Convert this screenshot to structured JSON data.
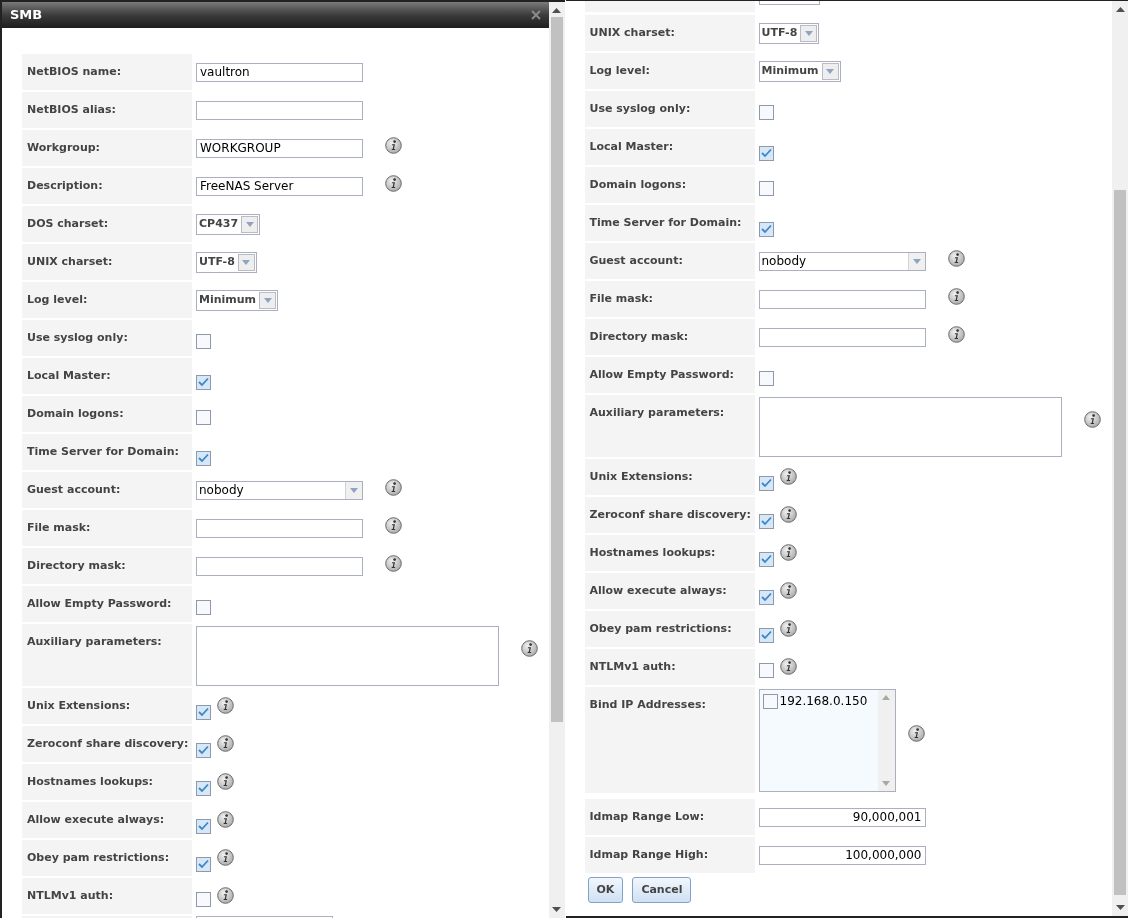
{
  "left": {
    "title": "SMB",
    "rows": [
      {
        "kind": "text",
        "label": "NetBIOS name:",
        "value": "vaultron",
        "info": false
      },
      {
        "kind": "text",
        "label": "NetBIOS alias:",
        "info": false
      },
      {
        "kind": "text",
        "label": "Workgroup:",
        "value": "WORKGROUP",
        "info": true
      },
      {
        "kind": "text",
        "label": "Description:",
        "value": "FreeNAS Server",
        "info": true
      },
      {
        "kind": "select",
        "label": "DOS charset:",
        "value": "CP437",
        "info": false
      },
      {
        "kind": "select",
        "label": "UNIX charset:",
        "value": "UTF-8",
        "info": false
      },
      {
        "kind": "select",
        "label": "Log level:",
        "value": "Minimum",
        "info": false
      },
      {
        "kind": "checkbox",
        "label": "Use syslog only:",
        "checked": false,
        "info": false
      },
      {
        "kind": "checkbox",
        "label": "Local Master:",
        "checked": true,
        "info": false
      },
      {
        "kind": "checkbox",
        "label": "Domain logons:",
        "checked": false,
        "info": false
      },
      {
        "kind": "checkbox",
        "label": "Time Server for Domain:",
        "checked": true,
        "info": false
      },
      {
        "kind": "combo",
        "label": "Guest account:",
        "value": "nobody",
        "info": true
      },
      {
        "kind": "text",
        "label": "File mask:",
        "info": true
      },
      {
        "kind": "text",
        "label": "Directory mask:",
        "info": true
      },
      {
        "kind": "checkbox",
        "label": "Allow Empty Password:",
        "checked": false,
        "info": false
      },
      {
        "kind": "textarea",
        "label": "Auxiliary parameters:",
        "info": true
      },
      {
        "kind": "checkbox",
        "label": "Unix Extensions:",
        "checked": true,
        "info": true
      },
      {
        "kind": "checkbox",
        "label": "Zeroconf share discovery:",
        "checked": true,
        "info": true
      },
      {
        "kind": "checkbox",
        "label": "Hostnames lookups:",
        "checked": true,
        "info": true
      },
      {
        "kind": "checkbox",
        "label": "Allow execute always:",
        "checked": true,
        "info": true
      },
      {
        "kind": "checkbox",
        "label": "Obey pam restrictions:",
        "checked": true,
        "info": true
      },
      {
        "kind": "checkbox",
        "label": "NTLMv1 auth:",
        "checked": false,
        "info": true
      }
    ]
  },
  "right": {
    "rows": [
      {
        "kind": "select",
        "label": "UNIX charset:",
        "value": "UTF-8",
        "info": false
      },
      {
        "kind": "select",
        "label": "Log level:",
        "value": "Minimum",
        "info": false
      },
      {
        "kind": "checkbox",
        "label": "Use syslog only:",
        "checked": false,
        "info": false
      },
      {
        "kind": "checkbox",
        "label": "Local Master:",
        "checked": true,
        "info": false
      },
      {
        "kind": "checkbox",
        "label": "Domain logons:",
        "checked": false,
        "info": false
      },
      {
        "kind": "checkbox",
        "label": "Time Server for Domain:",
        "checked": true,
        "info": false
      },
      {
        "kind": "combo",
        "label": "Guest account:",
        "value": "nobody",
        "info": true
      },
      {
        "kind": "text",
        "label": "File mask:",
        "info": true
      },
      {
        "kind": "text",
        "label": "Directory mask:",
        "info": true
      },
      {
        "kind": "checkbox",
        "label": "Allow Empty Password:",
        "checked": false,
        "info": false
      },
      {
        "kind": "textarea",
        "label": "Auxiliary parameters:",
        "info": true
      },
      {
        "kind": "checkbox",
        "label": "Unix Extensions:",
        "checked": true,
        "info": true
      },
      {
        "kind": "checkbox",
        "label": "Zeroconf share discovery:",
        "checked": true,
        "info": true
      },
      {
        "kind": "checkbox",
        "label": "Hostnames lookups:",
        "checked": true,
        "info": true
      },
      {
        "kind": "checkbox",
        "label": "Allow execute always:",
        "checked": true,
        "info": true
      },
      {
        "kind": "checkbox",
        "label": "Obey pam restrictions:",
        "checked": true,
        "info": true
      },
      {
        "kind": "checkbox",
        "label": "NTLMv1 auth:",
        "checked": false,
        "info": true
      },
      {
        "kind": "listbox",
        "label": "Bind IP Addresses:",
        "items": [
          {
            "label": "192.168.0.150",
            "checked": false
          }
        ],
        "info": true
      },
      {
        "kind": "number",
        "label": "Idmap Range Low:",
        "value": "90,000,001",
        "info": false
      },
      {
        "kind": "number",
        "label": "Idmap Range High:",
        "value": "100,000,000",
        "info": false
      }
    ],
    "buttons": [
      "OK",
      "Cancel"
    ]
  }
}
